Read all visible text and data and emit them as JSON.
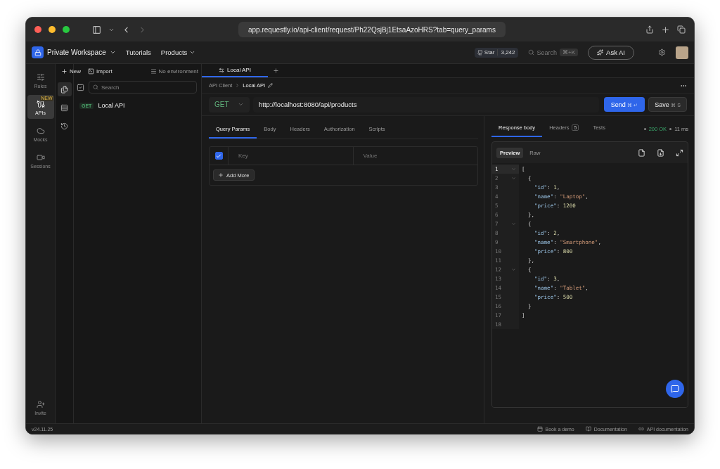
{
  "browser": {
    "url": "app.requestly.io/api-client/request/Ph22QsjBj1EtsaAzoHRS?tab=query_params"
  },
  "header": {
    "workspace": "Private Workspace",
    "nav": [
      {
        "label": "Tutorials",
        "menu": false
      },
      {
        "label": "Products",
        "menu": true
      }
    ],
    "star_label": "Star",
    "star_count": "3,242",
    "search_placeholder": "Search",
    "search_shortcut": "⌘+K",
    "ask_ai": "Ask AI"
  },
  "rail": {
    "items": [
      {
        "label": "Rules",
        "kind": "rules",
        "selected": false
      },
      {
        "label": "APIs",
        "kind": "apis",
        "selected": true,
        "badge": "NEW"
      },
      {
        "label": "Mocks",
        "kind": "mocks",
        "selected": false
      },
      {
        "label": "Sessions",
        "kind": "sessions",
        "selected": false
      }
    ],
    "invite": "Invite"
  },
  "panels": [
    {
      "kind": "collections",
      "selected": true
    },
    {
      "kind": "environments",
      "selected": false
    },
    {
      "kind": "history",
      "selected": false
    }
  ],
  "sidebar": {
    "new": "New",
    "import": "Import",
    "environment": "No environment",
    "search_placeholder": "Search",
    "items": [
      {
        "method": "GET",
        "name": "Local API"
      }
    ]
  },
  "tabs": [
    {
      "label": "Local API",
      "selected": true
    }
  ],
  "breadcrumb": [
    "API Client",
    "Local API"
  ],
  "request": {
    "method": "GET",
    "url": "http://localhost:8080/api/products",
    "send": "Send",
    "send_shortcut": "⌘ ↵",
    "save": "Save",
    "save_shortcut": "⌘ S"
  },
  "request_tabs": [
    {
      "label": "Query Params",
      "selected": true
    },
    {
      "label": "Body",
      "selected": false
    },
    {
      "label": "Headers",
      "selected": false
    },
    {
      "label": "Authorization",
      "selected": false
    },
    {
      "label": "Scripts",
      "selected": false
    }
  ],
  "params": {
    "checked": true,
    "key_placeholder": "Key",
    "value_placeholder": "Value",
    "add": "Add More"
  },
  "response": {
    "tabs": [
      {
        "label": "Response body",
        "selected": true
      },
      {
        "label": "Headers",
        "count": "5",
        "selected": false
      },
      {
        "label": "Tests",
        "selected": false
      }
    ],
    "status": "200 OK",
    "time": "11 ms",
    "views": [
      {
        "label": "Preview",
        "selected": true
      },
      {
        "label": "Raw",
        "selected": false
      }
    ],
    "lines": [
      {
        "number": "1",
        "fold": true,
        "current": true,
        "tokens": [
          {
            "kind": "punct",
            "text": "["
          }
        ]
      },
      {
        "number": "2",
        "fold": true,
        "current": false,
        "tokens": [
          {
            "kind": "punct",
            "text": "  {"
          }
        ]
      },
      {
        "number": "3",
        "fold": false,
        "current": false,
        "tokens": [
          {
            "kind": "key",
            "text": "    \"id\""
          },
          {
            "kind": "punct",
            "text": ": "
          },
          {
            "kind": "number",
            "text": "1"
          },
          {
            "kind": "punct",
            "text": ","
          }
        ]
      },
      {
        "number": "4",
        "fold": false,
        "current": false,
        "tokens": [
          {
            "kind": "key",
            "text": "    \"name\""
          },
          {
            "kind": "punct",
            "text": ": "
          },
          {
            "kind": "string",
            "text": "\"Laptop\""
          },
          {
            "kind": "punct",
            "text": ","
          }
        ]
      },
      {
        "number": "5",
        "fold": false,
        "current": false,
        "tokens": [
          {
            "kind": "key",
            "text": "    \"price\""
          },
          {
            "kind": "punct",
            "text": ": "
          },
          {
            "kind": "number",
            "text": "1200"
          }
        ]
      },
      {
        "number": "6",
        "fold": false,
        "current": false,
        "tokens": [
          {
            "kind": "punct",
            "text": "  },"
          }
        ]
      },
      {
        "number": "7",
        "fold": true,
        "current": false,
        "tokens": [
          {
            "kind": "punct",
            "text": "  {"
          }
        ]
      },
      {
        "number": "8",
        "fold": false,
        "current": false,
        "tokens": [
          {
            "kind": "key",
            "text": "    \"id\""
          },
          {
            "kind": "punct",
            "text": ": "
          },
          {
            "kind": "number",
            "text": "2"
          },
          {
            "kind": "punct",
            "text": ","
          }
        ]
      },
      {
        "number": "9",
        "fold": false,
        "current": false,
        "tokens": [
          {
            "kind": "key",
            "text": "    \"name\""
          },
          {
            "kind": "punct",
            "text": ": "
          },
          {
            "kind": "string",
            "text": "\"Smartphone\""
          },
          {
            "kind": "punct",
            "text": ","
          }
        ]
      },
      {
        "number": "10",
        "fold": false,
        "current": false,
        "tokens": [
          {
            "kind": "key",
            "text": "    \"price\""
          },
          {
            "kind": "punct",
            "text": ": "
          },
          {
            "kind": "number",
            "text": "800"
          }
        ]
      },
      {
        "number": "11",
        "fold": false,
        "current": false,
        "tokens": [
          {
            "kind": "punct",
            "text": "  },"
          }
        ]
      },
      {
        "number": "12",
        "fold": true,
        "current": false,
        "tokens": [
          {
            "kind": "punct",
            "text": "  {"
          }
        ]
      },
      {
        "number": "13",
        "fold": false,
        "current": false,
        "tokens": [
          {
            "kind": "key",
            "text": "    \"id\""
          },
          {
            "kind": "punct",
            "text": ": "
          },
          {
            "kind": "number",
            "text": "3"
          },
          {
            "kind": "punct",
            "text": ","
          }
        ]
      },
      {
        "number": "14",
        "fold": false,
        "current": false,
        "tokens": [
          {
            "kind": "key",
            "text": "    \"name\""
          },
          {
            "kind": "punct",
            "text": ": "
          },
          {
            "kind": "string",
            "text": "\"Tablet\""
          },
          {
            "kind": "punct",
            "text": ","
          }
        ]
      },
      {
        "number": "15",
        "fold": false,
        "current": false,
        "tokens": [
          {
            "kind": "key",
            "text": "    \"price\""
          },
          {
            "kind": "punct",
            "text": ": "
          },
          {
            "kind": "number",
            "text": "500"
          }
        ]
      },
      {
        "number": "16",
        "fold": false,
        "current": false,
        "tokens": [
          {
            "kind": "punct",
            "text": "  }"
          }
        ]
      },
      {
        "number": "17",
        "fold": false,
        "current": false,
        "tokens": [
          {
            "kind": "punct",
            "text": "]"
          }
        ]
      },
      {
        "number": "18",
        "fold": false,
        "current": false
      }
    ]
  },
  "status_bar": {
    "version": "v24.11.25",
    "links": [
      {
        "label": "Book a demo",
        "kind": "calendar"
      },
      {
        "label": "Documentation",
        "kind": "book"
      },
      {
        "label": "API documentation",
        "kind": "link"
      }
    ]
  }
}
